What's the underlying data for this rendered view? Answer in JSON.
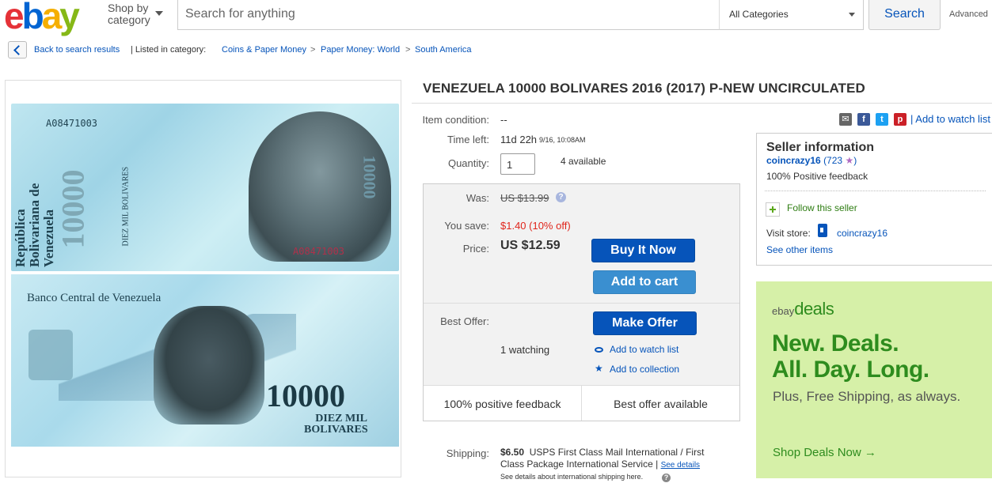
{
  "header": {
    "logo": {
      "e": "e",
      "b": "b",
      "a": "a",
      "y": "y"
    },
    "shop_by_line1": "Shop by",
    "shop_by_line2": "category",
    "search_placeholder": "Search for anything",
    "category_selected": "All Categories",
    "search_button": "Search",
    "advanced": "Advanced"
  },
  "breadcrumb": {
    "back": "Back to search results",
    "listed_in": "| Listed in category:",
    "items": [
      "Coins & Paper Money",
      "Paper Money: World",
      "South America"
    ],
    "separator": ">"
  },
  "banknote": {
    "serial": "A08471003",
    "republic": "República Bolivariana de Venezuela",
    "denomination": "10000",
    "diez_mil": "DIEZ MIL BOLIVARES",
    "bank": "Banco Central de Venezuela",
    "diez_mil_back_1": "DIEZ MIL",
    "diez_mil_back_2": "BOLIVARES"
  },
  "listing": {
    "title": "VENEZUELA 10000 BOLIVARES 2016 (2017) P-NEW UNCIRCULATED",
    "condition_label": "Item condition:",
    "condition_value": "--",
    "time_left_label": "Time left:",
    "time_left_value": "11d 22h",
    "time_left_date": "9/16, 10:08AM",
    "quantity_label": "Quantity:",
    "quantity_value": "1",
    "available": "4 available",
    "was_label": "Was:",
    "was_value": "US $13.99",
    "save_label": "You save:",
    "save_value": "$1.40 (10% off)",
    "price_label": "Price:",
    "price_value": "US $12.59",
    "buy_now": "Buy It Now",
    "add_to_cart": "Add to cart",
    "best_offer_label": "Best Offer:",
    "make_offer": "Make Offer",
    "watching": "1 watching",
    "add_watch": "Add to watch list",
    "add_collection": "Add to collection",
    "positive_feedback": "100% positive feedback",
    "best_offer_available": "Best offer available",
    "shipping_label": "Shipping:",
    "shipping_price": "$6.50",
    "shipping_service_1": "USPS First Class Mail International / First",
    "shipping_service_2": "Class Package International Service |",
    "see_details": "See details",
    "intl_note": "See details about international shipping here."
  },
  "share": {
    "add_watch_link": "| Add to watch list",
    "colors": {
      "email": "#666666",
      "facebook": "#3b5998",
      "twitter": "#1da1f2",
      "pinterest": "#cb2027"
    }
  },
  "seller": {
    "heading": "Seller information",
    "name": "coincrazy16",
    "score_open": "(723",
    "score_close": ")",
    "feedback": "100% Positive feedback",
    "follow": "Follow this seller",
    "visit_store_label": "Visit store:",
    "store_name": "coincrazy16",
    "see_other": "See other items"
  },
  "deals": {
    "logo_small": "ebay",
    "logo_big": "deals",
    "headline_1": "New. Deals.",
    "headline_2": "All. Day. Long.",
    "sub": "Plus, Free Shipping, as always.",
    "link": "Shop Deals Now",
    "arrow": "→"
  },
  "colors": {
    "link": "#0654ba",
    "accent_red": "#e0251b",
    "deals_green": "#2e8c1e",
    "deals_bg": "#d6f0a8"
  }
}
